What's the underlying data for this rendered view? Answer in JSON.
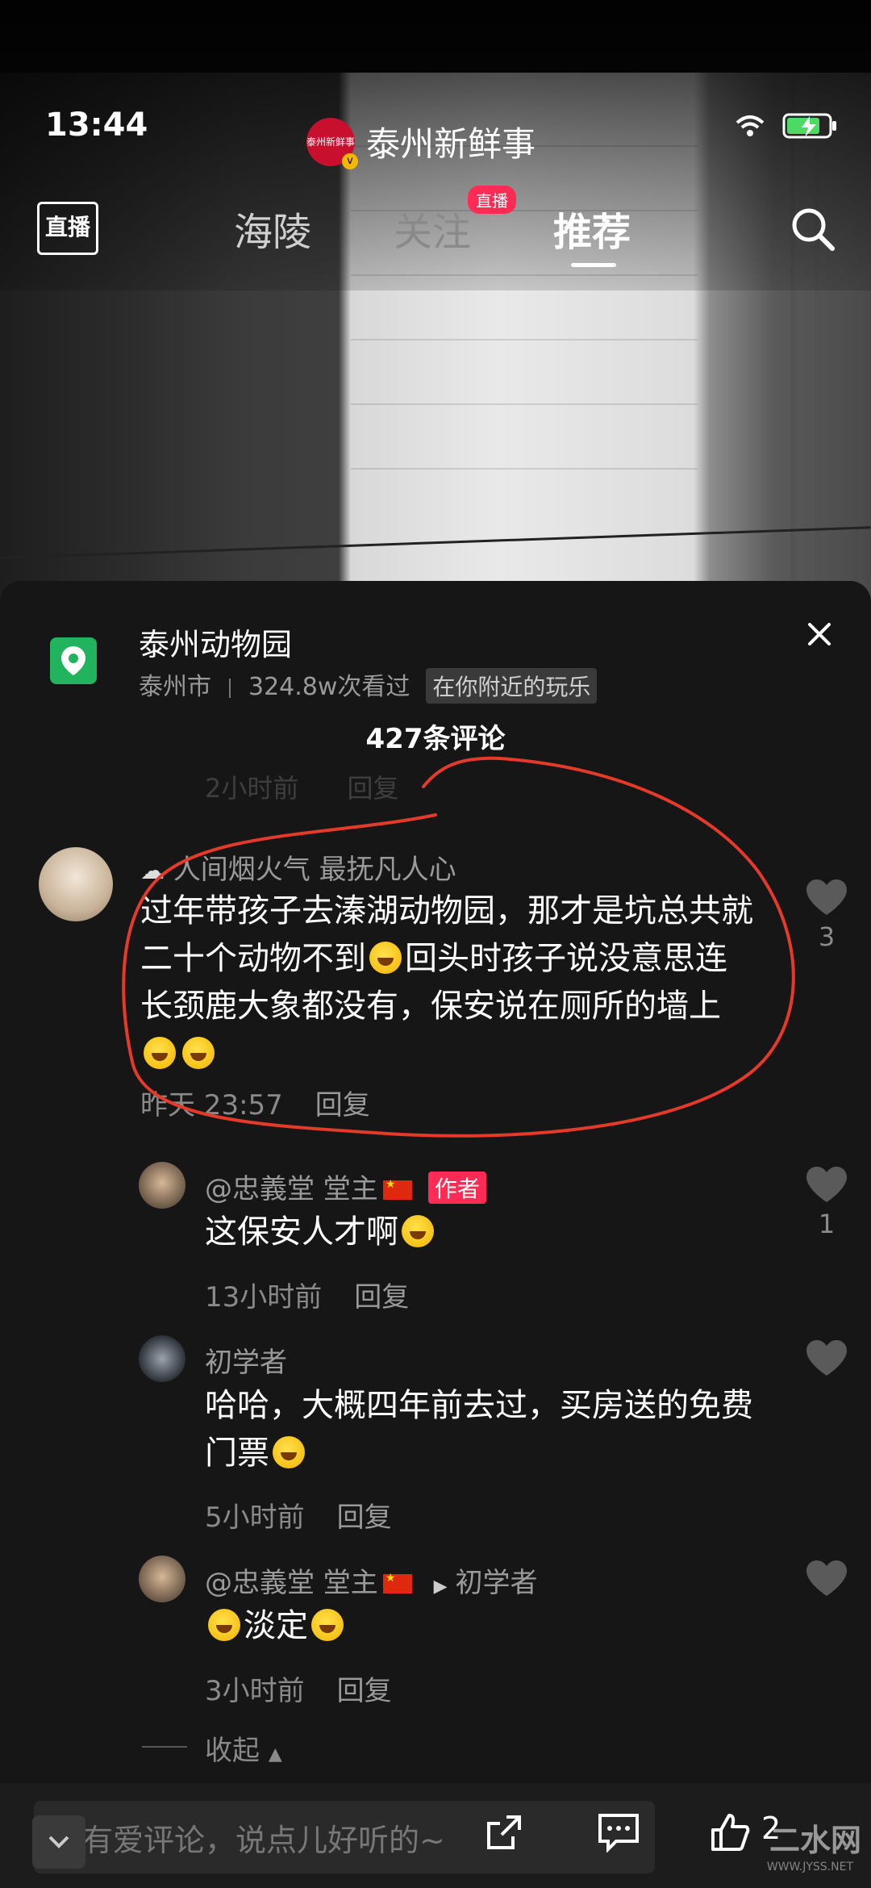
{
  "status_bar": {
    "time": "13:44"
  },
  "account": {
    "avatar_text": "泰州新鲜事",
    "name": "泰州新鲜事"
  },
  "top_tabs": {
    "live_label": "直播",
    "tabs": [
      "海陵",
      "关注",
      "推荐"
    ],
    "live_tag": "直播"
  },
  "poi": {
    "title": "泰州动物园",
    "city": "泰州市",
    "views": "324.8w次看过",
    "chip": "在你附近的玩乐"
  },
  "comment_count": "427条评论",
  "faded_meta": {
    "time": "2小时前",
    "reply": "回复"
  },
  "comments": [
    {
      "username": "人间烟火气 最抚凡人心",
      "text_a": "过年带孩子去溱湖动物园，那才是坑总共就二十个动物不到",
      "text_b": "回头时孩子说没意思连长颈鹿大象都没有，保安说在厕所的墙上",
      "time": "昨天 23:57",
      "reply": "回复",
      "likes": "3"
    },
    {
      "username": "@忠義堂 堂主",
      "author_tag": "作者",
      "text": "这保安人才啊",
      "time": "13小时前",
      "reply": "回复",
      "likes": "1"
    },
    {
      "username": "初学者",
      "text": "哈哈，大概四年前去过，买房送的免费门票",
      "time": "5小时前",
      "reply": "回复"
    },
    {
      "username": "@忠義堂 堂主",
      "reply_to": "初学者",
      "text": "淡定",
      "time": "3小时前",
      "reply": "回复"
    }
  ],
  "collapse_label": "收起",
  "bottom_bar": {
    "placeholder": "有爱评论，说点儿好听的~",
    "like_count": "2"
  },
  "watermark": {
    "main": "二水网",
    "sub": "WWW.JYSS.NET"
  },
  "colors": {
    "accent": "#fe2c55",
    "annotation": "#e53a2a",
    "poi_green": "#22b35e"
  }
}
